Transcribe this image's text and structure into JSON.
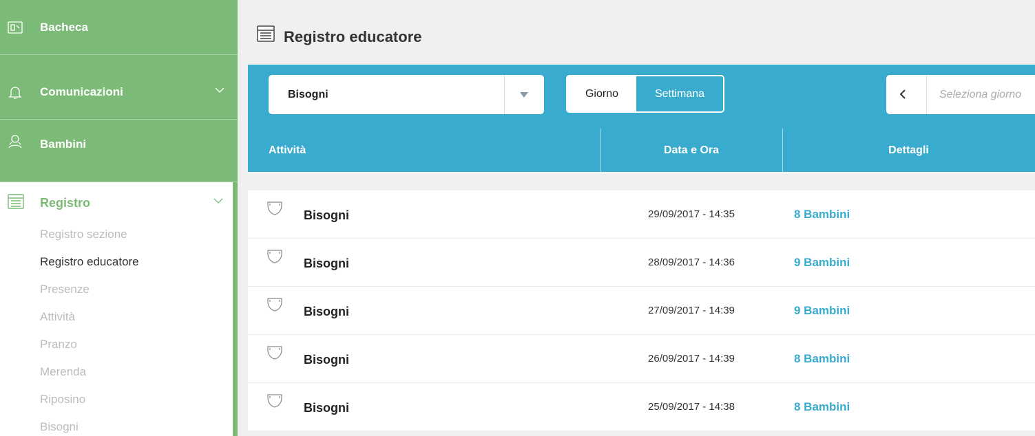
{
  "sidebar": {
    "items": [
      {
        "label": "Bacheca",
        "icon": "board-icon"
      },
      {
        "label": "Comunicazioni",
        "icon": "bell-icon"
      },
      {
        "label": "Bambini",
        "icon": "children-icon"
      }
    ],
    "registro": {
      "label": "Registro",
      "icon": "register-icon",
      "sub_items": [
        {
          "label": "Registro sezione",
          "active": false
        },
        {
          "label": "Registro educatore",
          "active": true
        },
        {
          "label": "Presenze",
          "active": false
        },
        {
          "label": "Attività",
          "active": false
        },
        {
          "label": "Pranzo",
          "active": false
        },
        {
          "label": "Merenda",
          "active": false
        },
        {
          "label": "Riposino",
          "active": false
        },
        {
          "label": "Bisogni",
          "active": false
        }
      ]
    }
  },
  "main": {
    "title": "Registro educatore",
    "filter": {
      "selected": "Bisogni"
    },
    "period_toggle": {
      "options": [
        "Giorno",
        "Settimana"
      ],
      "selected": "Settimana"
    },
    "date_picker": {
      "placeholder": "Seleziona giorno"
    },
    "table": {
      "headers": [
        "Attività",
        "Data e Ora",
        "Dettagli"
      ],
      "rows": [
        {
          "activity": "Bisogni",
          "datetime": "29/09/2017 - 14:35",
          "details": "8 Bambini"
        },
        {
          "activity": "Bisogni",
          "datetime": "28/09/2017 - 14:36",
          "details": "9 Bambini"
        },
        {
          "activity": "Bisogni",
          "datetime": "27/09/2017 - 14:39",
          "details": "9 Bambini"
        },
        {
          "activity": "Bisogni",
          "datetime": "26/09/2017 - 14:39",
          "details": "8 Bambini"
        },
        {
          "activity": "Bisogni",
          "datetime": "25/09/2017 - 14:38",
          "details": "8 Bambini"
        }
      ]
    }
  },
  "colors": {
    "sidebar_green": "#7cbb77",
    "header_blue": "#39abcf",
    "link_blue": "#39abcf",
    "muted_text": "#bcbcbc"
  }
}
